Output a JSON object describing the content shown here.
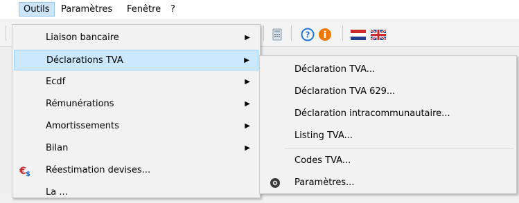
{
  "menubar": {
    "items": [
      "Outils",
      "Paramètres",
      "Fenêtre",
      "?"
    ]
  },
  "menu": {
    "items": [
      {
        "label": "Liaison bancaire",
        "has_submenu": true
      },
      {
        "label": "Déclarations TVA",
        "has_submenu": true,
        "highlighted": true
      },
      {
        "label": "Ecdf",
        "has_submenu": true
      },
      {
        "label": "Rémunérations",
        "has_submenu": true
      },
      {
        "label": "Amortissements",
        "has_submenu": true
      },
      {
        "label": "Bilan",
        "has_submenu": true
      },
      {
        "label": "Réestimation devises...",
        "icon": "euro-dollar-icon"
      },
      {
        "label": "La ...",
        "partial": true
      }
    ],
    "arrow_glyph": "▶"
  },
  "submenu": {
    "items": [
      {
        "label": "Déclaration TVA..."
      },
      {
        "label": "Déclaration TVA 629..."
      },
      {
        "label": "Déclaration intracommunautaire..."
      },
      {
        "label": "Listing TVA..."
      },
      {
        "label": "Codes TVA..."
      },
      {
        "label": "Paramètres...",
        "icon": "gear-icon"
      }
    ]
  },
  "toolbar": {
    "icons": [
      "calculator-icon",
      "help-icon",
      "info-icon",
      "flag-nl-icon",
      "flag-uk-icon"
    ]
  },
  "colors": {
    "highlight": "#cce8ff",
    "highlight_border": "#99d1ff",
    "help_blue": "#1e73d8",
    "info_orange": "#f07800"
  }
}
